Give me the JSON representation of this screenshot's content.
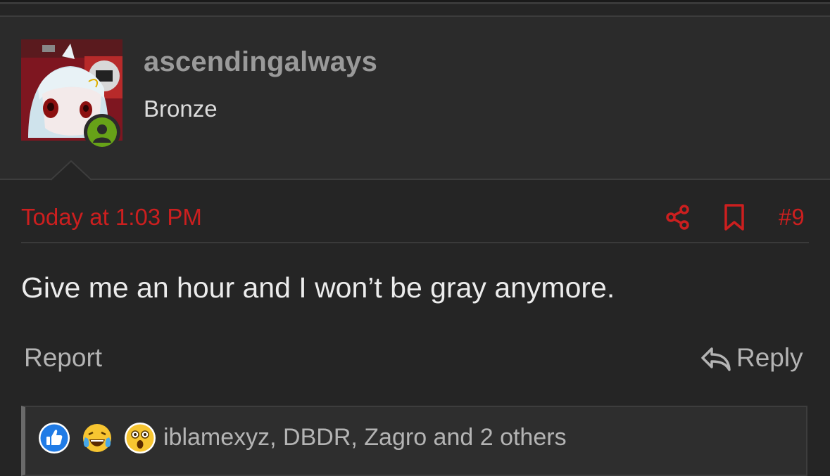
{
  "post": {
    "username": "ascendingalways",
    "rank": "Bronze",
    "date": "Today at 1:03 PM",
    "number": "#9",
    "message": "Give me an hour and I won’t be gray anymore.",
    "report_label": "Report",
    "reply_label": "Reply"
  },
  "reactions": {
    "icons": [
      "like-icon",
      "laugh-cry-icon",
      "shocked-icon"
    ],
    "summary": "iblamexyz, DBDR, Zagro and 2 others"
  },
  "colors": {
    "accent": "#cc1f1f",
    "online": "#67a218",
    "like": "#1f7be6"
  }
}
